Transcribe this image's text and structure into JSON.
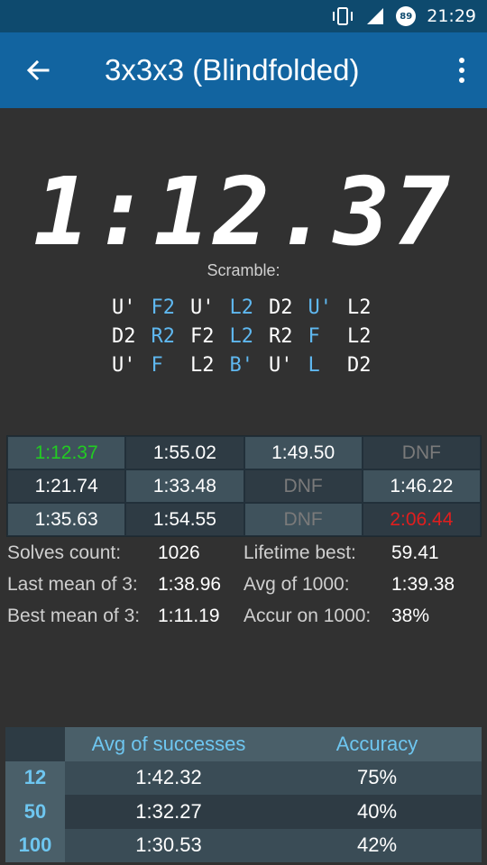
{
  "status_bar": {
    "time": "21:29",
    "battery": "89"
  },
  "app_bar": {
    "title": "3x3x3 (Blindfolded)"
  },
  "timer": {
    "value": "1:12.37",
    "scramble_label": "Scramble:"
  },
  "scramble": [
    [
      {
        "m": "U'",
        "c": "#ffffff"
      },
      {
        "m": "F2",
        "c": "#5fb8f0"
      },
      {
        "m": "U'",
        "c": "#ffffff"
      },
      {
        "m": "L2",
        "c": "#5fb8f0"
      },
      {
        "m": "D2",
        "c": "#ffffff"
      },
      {
        "m": "U'",
        "c": "#5fb8f0"
      },
      {
        "m": "L2",
        "c": "#ffffff"
      }
    ],
    [
      {
        "m": "D2",
        "c": "#ffffff"
      },
      {
        "m": "R2",
        "c": "#5fb8f0"
      },
      {
        "m": "F2",
        "c": "#ffffff"
      },
      {
        "m": "L2",
        "c": "#5fb8f0"
      },
      {
        "m": "R2",
        "c": "#ffffff"
      },
      {
        "m": "F",
        "c": "#5fb8f0"
      },
      {
        "m": "L2",
        "c": "#ffffff"
      }
    ],
    [
      {
        "m": "U'",
        "c": "#ffffff"
      },
      {
        "m": "F",
        "c": "#5fb8f0"
      },
      {
        "m": "L2",
        "c": "#ffffff"
      },
      {
        "m": "B'",
        "c": "#5fb8f0"
      },
      {
        "m": "U'",
        "c": "#ffffff"
      },
      {
        "m": "L",
        "c": "#5fb8f0"
      },
      {
        "m": "D2",
        "c": "#ffffff"
      }
    ]
  ],
  "results": [
    {
      "v": "1:12.37",
      "style": "green",
      "bg": "a"
    },
    {
      "v": "1:55.02",
      "style": "white",
      "bg": "b"
    },
    {
      "v": "1:49.50",
      "style": "white",
      "bg": "a"
    },
    {
      "v": "DNF",
      "style": "grey",
      "bg": "b"
    },
    {
      "v": "1:21.74",
      "style": "white",
      "bg": "b"
    },
    {
      "v": "1:33.48",
      "style": "white",
      "bg": "a"
    },
    {
      "v": "DNF",
      "style": "grey",
      "bg": "b"
    },
    {
      "v": "1:46.22",
      "style": "white",
      "bg": "a"
    },
    {
      "v": "1:35.63",
      "style": "white",
      "bg": "a"
    },
    {
      "v": "1:54.55",
      "style": "white",
      "bg": "b"
    },
    {
      "v": "DNF",
      "style": "grey",
      "bg": "a"
    },
    {
      "v": "2:06.44",
      "style": "red",
      "bg": "b"
    }
  ],
  "stats": {
    "solves_count_label": "Solves count:",
    "solves_count": "1026",
    "lifetime_best_label": "Lifetime best:",
    "lifetime_best": "59.41",
    "last_mean_label": "Last mean of 3:",
    "last_mean": "1:38.96",
    "avg_label": "Avg of 1000:",
    "avg": "1:39.38",
    "best_mean_label": "Best mean of 3:",
    "best_mean": "1:11.19",
    "accur_label": "Accur on 1000:",
    "accur": "38%"
  },
  "summary_table": {
    "headers": [
      "",
      "Avg of successes",
      "Accuracy"
    ],
    "rows": [
      {
        "n": "12",
        "avg": "1:42.32",
        "acc": "75%"
      },
      {
        "n": "50",
        "avg": "1:32.27",
        "acc": "40%"
      },
      {
        "n": "100",
        "avg": "1:30.53",
        "acc": "42%"
      }
    ]
  }
}
